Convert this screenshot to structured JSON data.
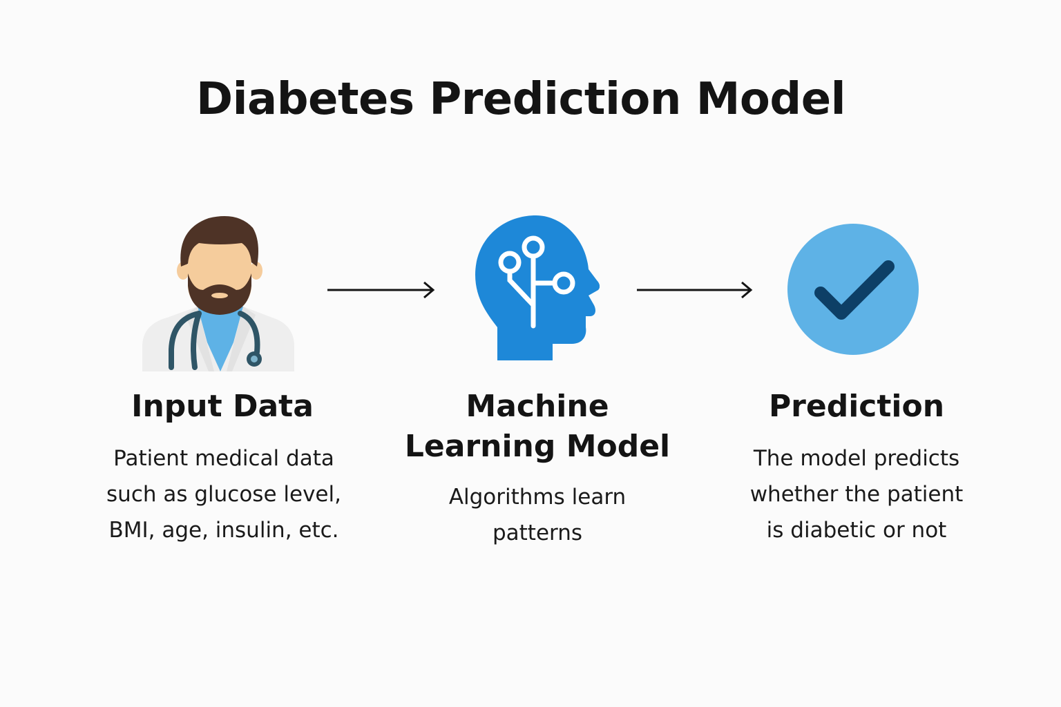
{
  "title": "Diabetes Prediction Model",
  "colors": {
    "background": "#fbfbfb",
    "text": "#141414",
    "brain_blue": "#1e88d8",
    "check_circle": "#5eb2e6",
    "check_mark": "#0d3f66",
    "doctor_hair": "#4e3326",
    "doctor_skin": "#f5cc9c",
    "doctor_scrubs": "#5eb2e6",
    "doctor_coat": "#eeeeee",
    "stethoscope": "#2f5566"
  },
  "steps": [
    {
      "icon": "doctor-icon",
      "title_lines": [
        "Input Data"
      ],
      "desc_lines": [
        "Patient medical data",
        "such as glucose level,",
        "BMI, age, insulin, etc."
      ]
    },
    {
      "icon": "brain-network-icon",
      "title_lines": [
        "Machine",
        "Learning Model"
      ],
      "desc_lines": [
        "Algorithms learn",
        "patterns"
      ]
    },
    {
      "icon": "check-circle-icon",
      "title_lines": [
        "Prediction"
      ],
      "desc_lines": [
        "The model predicts",
        "whether the patient",
        "is diabetic or not"
      ]
    }
  ]
}
